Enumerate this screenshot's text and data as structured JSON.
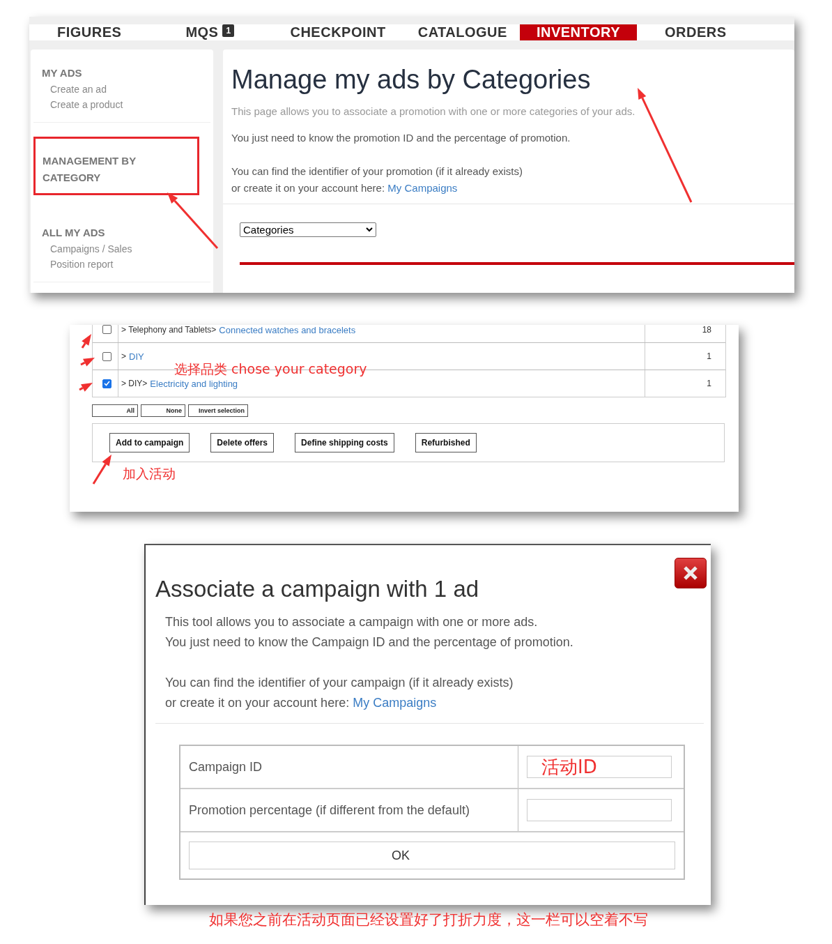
{
  "nav": {
    "tabs": [
      {
        "label": "FIGURES",
        "selected": false
      },
      {
        "label": "MQS",
        "badge": "1",
        "selected": false
      },
      {
        "label": "CHECKPOINT",
        "selected": false
      },
      {
        "label": "CATALOGUE",
        "selected": false
      },
      {
        "label": "INVENTORY",
        "selected": true
      },
      {
        "label": "ORDERS",
        "selected": false
      }
    ]
  },
  "sidebar": {
    "sections": [
      {
        "title": "MY ADS",
        "highlighted": false,
        "items": [
          "Create an ad",
          "Create a product"
        ]
      },
      {
        "title": "MANAGEMENT BY CATEGORY",
        "highlighted": true
      },
      {
        "title": "ALL MY ADS",
        "highlighted": false,
        "items": [
          "Campaigns / Sales",
          "Position report"
        ]
      }
    ]
  },
  "main": {
    "title": "Manage my ads by Categories",
    "intro": "This page allows you to associate a promotion with one or more categories of your ads.",
    "need": "You just need to know the promotion ID and the percentage of promotion.",
    "find": "You can find the identifier of your promotion (if it already exists)",
    "create": "or create it on your account here:",
    "link": "My Campaigns",
    "select": {
      "value": "Categories"
    }
  },
  "category_table": {
    "rows": [
      {
        "checked": false,
        "path": "> Telephony and Tablets>",
        "category": "Connected watches and bracelets",
        "count": "18"
      },
      {
        "checked": false,
        "path": ">",
        "category": "DIY",
        "count": "1"
      },
      {
        "checked": true,
        "path": "> DIY>",
        "category": "Electricity and lighting",
        "count": "1"
      }
    ],
    "selection_buttons": [
      "All",
      "None",
      "Invert selection"
    ],
    "actions": [
      "Add to campaign",
      "Delete offers",
      "Define shipping costs",
      "Refurbished"
    ]
  },
  "dialog": {
    "title": "Associate a campaign with 1 ad",
    "line1": "This tool allows you to associate a campaign with one or more ads.",
    "line2": "You just need to know the Campaign ID and the percentage of promotion.",
    "line3": "You can find the identifier of your campaign (if it already exists)",
    "line4": "or create it on your account here:",
    "link": "My Campaigns",
    "fields": [
      {
        "label": "Campaign ID",
        "value": "活动ID"
      },
      {
        "label": "Promotion percentage (if different from the default)"
      }
    ],
    "ok": "OK"
  },
  "annotations": [
    "选择品类 chose your category",
    "加入活动",
    "如果您之前在活动页面已经设置好了打折力度，这一栏可以空着不写"
  ]
}
